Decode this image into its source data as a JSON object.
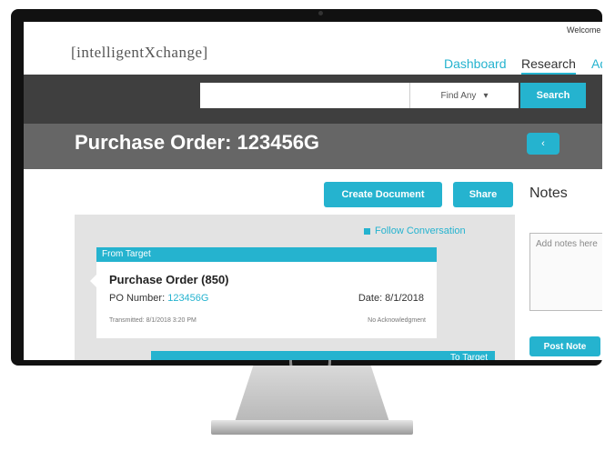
{
  "header": {
    "logo_text": "[intelligentXchange]",
    "welcome": "Welcome",
    "nav": [
      "Dashboard",
      "Research",
      "Ad"
    ]
  },
  "search": {
    "placeholder": "",
    "filter_value": "Find Any",
    "button_label": "Search"
  },
  "title_band": {
    "title": "Purchase Order: 123456G",
    "back_label": "‹"
  },
  "actions": {
    "create_document": "Create Document",
    "share": "Share"
  },
  "notes": {
    "title": "Notes",
    "placeholder": "Add notes here",
    "post_button": "Post Note"
  },
  "feed": {
    "follow": "Follow Conversation",
    "card": {
      "from": "From Target",
      "title": "Purchase Order (850)",
      "po_label": "PO Number:",
      "po_number": "123456G",
      "date": "Date: 8/1/2018",
      "transmitted": "Transmitted: 8/1/2018 3:20 PM",
      "ack": "No Acknowledgment"
    },
    "card2_head": "To Target"
  },
  "colors": {
    "accent": "#25b3cf",
    "dark_band": "#3f3f3f",
    "title_band": "#666666"
  }
}
